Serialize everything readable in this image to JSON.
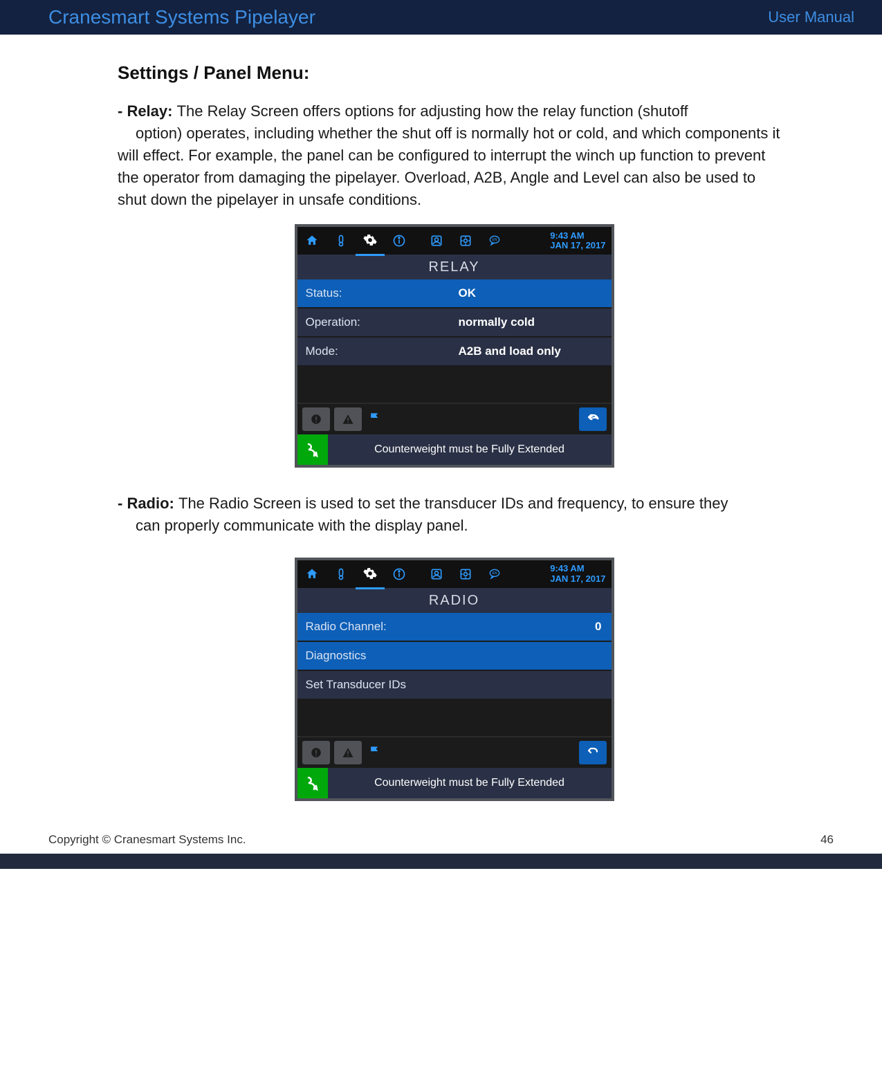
{
  "header": {
    "left": "Cranesmart Systems Pipelayer",
    "right": "User Manual"
  },
  "section_heading": "Settings / Panel Menu:",
  "relay": {
    "lead": "- Relay:  ",
    "body_first": "The Relay Screen offers options for adjusting how the relay function (shutoff ",
    "body_rest": "option) operates, including whether the shut off is normally hot or cold, and which components it will effect.  For example, the panel can be configured to interrupt the winch up function to prevent the operator from damaging the pipelayer.  Overload, A2B, Angle and Level can also be used to shut down the pipelayer in unsafe conditions."
  },
  "radio": {
    "lead": "- Radio:  ",
    "body_first": "The Radio Screen is used to set the transducer IDs and frequency, to ensure they ",
    "body_rest": "can properly communicate with the display panel."
  },
  "panel_common": {
    "time": "9:43 AM",
    "date": "JAN 17, 2017",
    "status_msg": "Counterweight must be Fully Extended"
  },
  "panel_relay": {
    "title": "RELAY",
    "rows": {
      "status_lbl": "Status:",
      "status_val": "OK",
      "operation_lbl": "Operation:",
      "operation_val": "normally cold",
      "mode_lbl": "Mode:",
      "mode_val": "A2B and load only"
    }
  },
  "panel_radio": {
    "title": "RADIO",
    "rows": {
      "channel_lbl": "Radio Channel:",
      "channel_val": "0",
      "diag_lbl": "Diagnostics",
      "ids_lbl": "Set Transducer IDs"
    }
  },
  "footer": {
    "copyright": "Copyright © Cranesmart Systems Inc.",
    "page": "46"
  }
}
